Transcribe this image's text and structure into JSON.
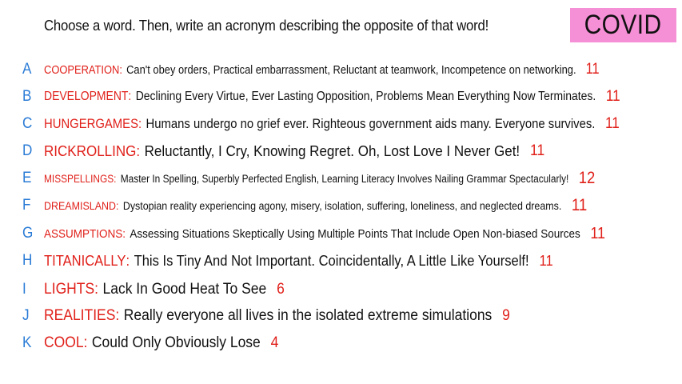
{
  "prompt": "Choose a word. Then, write an acronym describing the opposite of that word!",
  "badge": "COVID",
  "entries": [
    {
      "letter": "A",
      "word": "COOPERATION",
      "acronym": "Can't obey orders, Practical embarrassment, Reluctant at teamwork, Incompetence on networking.",
      "count": "11"
    },
    {
      "letter": "B",
      "word": "DEVELOPMENT",
      "acronym": "Declining Every Virtue, Ever Lasting Opposition, Problems Mean Everything Now Terminates.",
      "count": "11"
    },
    {
      "letter": "C",
      "word": "HUNGERGAMES",
      "acronym": "Humans undergo no grief ever. Righteous government aids many. Everyone survives.",
      "count": "11"
    },
    {
      "letter": "D",
      "word": "RICKROLLING",
      "acronym": "Reluctantly, I Cry, Knowing Regret. Oh, Lost Love I Never Get!",
      "count": "11"
    },
    {
      "letter": "E",
      "word": "MISSPELLINGS",
      "acronym": "Master In Spelling, Superbly Perfected English, Learning Literacy Involves Nailing Grammar Spectacularly!",
      "count": "12"
    },
    {
      "letter": "F",
      "word": "DREAMISLAND",
      "acronym": "Dystopian reality experiencing agony, misery, isolation, suffering, loneliness, and neglected dreams.",
      "count": "11"
    },
    {
      "letter": "G",
      "word": "ASSUMPTIONS",
      "acronym": "Assessing Situations Skeptically Using Multiple Points That Include Open Non-biased Sources",
      "count": "11"
    },
    {
      "letter": "H",
      "word": "TITANICALLY",
      "acronym": "This Is Tiny And Not Important. Coincidentally, A Little Like Yourself!",
      "count": "11"
    },
    {
      "letter": "I",
      "word": "LIGHTS",
      "acronym": "Lack In Good Heat To See",
      "count": "6"
    },
    {
      "letter": "J",
      "word": "REALITIES",
      "acronym": "Really everyone all lives in the isolated extreme simulations",
      "count": "9"
    },
    {
      "letter": "K",
      "word": "COOL",
      "acronym": "Could Only Obviously Lose",
      "count": "4"
    }
  ]
}
